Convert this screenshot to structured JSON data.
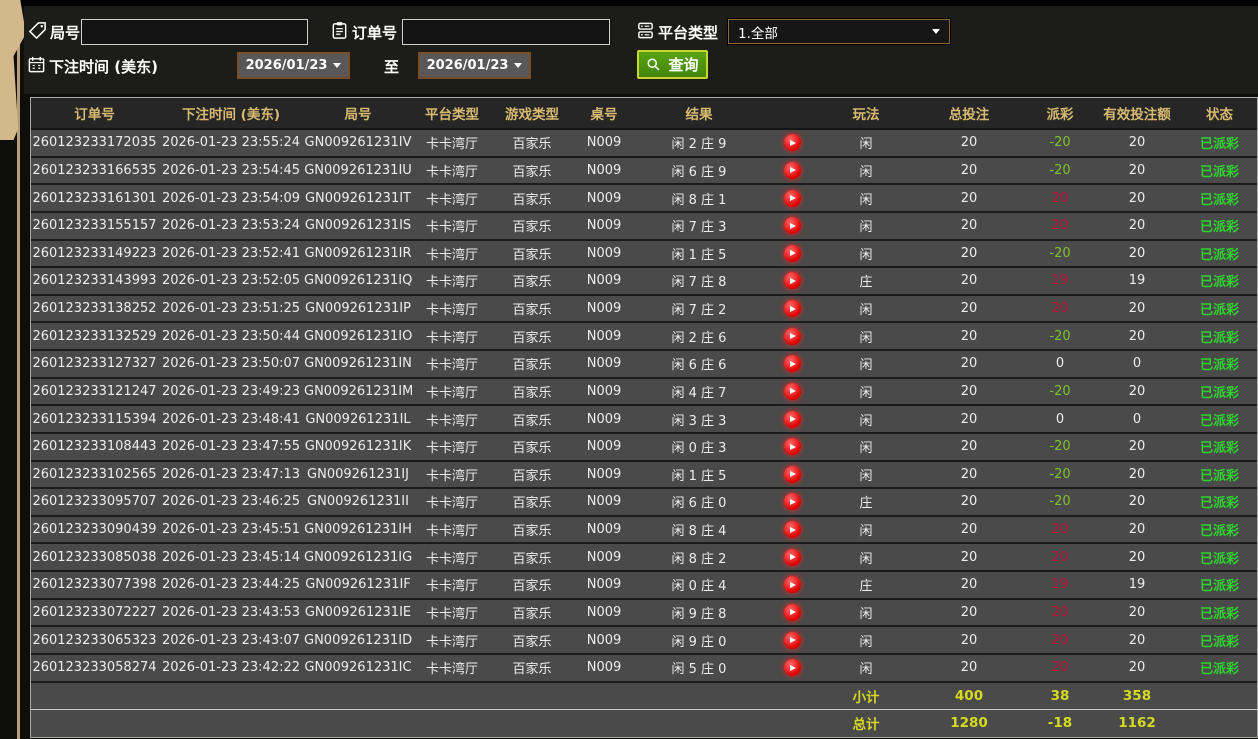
{
  "filter_bar": {
    "round": {
      "label": "局号",
      "value": "",
      "icon": "tag-icon"
    },
    "order": {
      "label": "订单号",
      "value": "",
      "icon": "clipboard-icon"
    },
    "platform": {
      "label": "平台类型",
      "value": "1.全部",
      "icon": "server-stack-icon"
    },
    "bet_time": {
      "label": "下注时间 (美东)",
      "icon": "calendar-icon",
      "from": "2026/01/23",
      "separator": "至",
      "to": "2026/01/23"
    },
    "search_button": {
      "label": "查询",
      "icon": "magnifier-icon"
    }
  },
  "table": {
    "headers": {
      "order": "订单号",
      "time": "下注时间 (美东)",
      "round": "局号",
      "platform": "平台类型",
      "game": "游戏类型",
      "table_no": "桌号",
      "result": "结果",
      "play": "玩法",
      "total_bet": "总投注",
      "payout": "派彩",
      "valid_bet": "有效投注额",
      "status": "状态"
    },
    "rows": [
      {
        "order": "260123233172035",
        "time": "2026-01-23 23:55:24",
        "round": "GN009261231IV",
        "platform": "卡卡湾厅",
        "game": "百家乐",
        "table_no": "N009",
        "result": "闲 2 庄 9",
        "play": "闲",
        "total_bet": "20",
        "payout": "-20",
        "valid_bet": "20",
        "status": "已派彩"
      },
      {
        "order": "260123233166535",
        "time": "2026-01-23 23:54:45",
        "round": "GN009261231IU",
        "platform": "卡卡湾厅",
        "game": "百家乐",
        "table_no": "N009",
        "result": "闲 6 庄 9",
        "play": "闲",
        "total_bet": "20",
        "payout": "-20",
        "valid_bet": "20",
        "status": "已派彩"
      },
      {
        "order": "260123233161301",
        "time": "2026-01-23 23:54:09",
        "round": "GN009261231IT",
        "platform": "卡卡湾厅",
        "game": "百家乐",
        "table_no": "N009",
        "result": "闲 8 庄 1",
        "play": "闲",
        "total_bet": "20",
        "payout": "20",
        "valid_bet": "20",
        "status": "已派彩"
      },
      {
        "order": "260123233155157",
        "time": "2026-01-23 23:53:24",
        "round": "GN009261231IS",
        "platform": "卡卡湾厅",
        "game": "百家乐",
        "table_no": "N009",
        "result": "闲 7 庄 3",
        "play": "闲",
        "total_bet": "20",
        "payout": "20",
        "valid_bet": "20",
        "status": "已派彩"
      },
      {
        "order": "260123233149223",
        "time": "2026-01-23 23:52:41",
        "round": "GN009261231IR",
        "platform": "卡卡湾厅",
        "game": "百家乐",
        "table_no": "N009",
        "result": "闲 1 庄 5",
        "play": "闲",
        "total_bet": "20",
        "payout": "-20",
        "valid_bet": "20",
        "status": "已派彩"
      },
      {
        "order": "260123233143993",
        "time": "2026-01-23 23:52:05",
        "round": "GN009261231IQ",
        "platform": "卡卡湾厅",
        "game": "百家乐",
        "table_no": "N009",
        "result": "闲 7 庄 8",
        "play": "庄",
        "total_bet": "20",
        "payout": "19",
        "valid_bet": "19",
        "status": "已派彩"
      },
      {
        "order": "260123233138252",
        "time": "2026-01-23 23:51:25",
        "round": "GN009261231IP",
        "platform": "卡卡湾厅",
        "game": "百家乐",
        "table_no": "N009",
        "result": "闲 7 庄 2",
        "play": "闲",
        "total_bet": "20",
        "payout": "20",
        "valid_bet": "20",
        "status": "已派彩"
      },
      {
        "order": "260123233132529",
        "time": "2026-01-23 23:50:44",
        "round": "GN009261231IO",
        "platform": "卡卡湾厅",
        "game": "百家乐",
        "table_no": "N009",
        "result": "闲 2 庄 6",
        "play": "闲",
        "total_bet": "20",
        "payout": "-20",
        "valid_bet": "20",
        "status": "已派彩"
      },
      {
        "order": "260123233127327",
        "time": "2026-01-23 23:50:07",
        "round": "GN009261231IN",
        "platform": "卡卡湾厅",
        "game": "百家乐",
        "table_no": "N009",
        "result": "闲 6 庄 6",
        "play": "闲",
        "total_bet": "20",
        "payout": "0",
        "valid_bet": "0",
        "status": "已派彩"
      },
      {
        "order": "260123233121247",
        "time": "2026-01-23 23:49:23",
        "round": "GN009261231IM",
        "platform": "卡卡湾厅",
        "game": "百家乐",
        "table_no": "N009",
        "result": "闲 4 庄 7",
        "play": "闲",
        "total_bet": "20",
        "payout": "-20",
        "valid_bet": "20",
        "status": "已派彩"
      },
      {
        "order": "260123233115394",
        "time": "2026-01-23 23:48:41",
        "round": "GN009261231IL",
        "platform": "卡卡湾厅",
        "game": "百家乐",
        "table_no": "N009",
        "result": "闲 3 庄 3",
        "play": "闲",
        "total_bet": "20",
        "payout": "0",
        "valid_bet": "0",
        "status": "已派彩"
      },
      {
        "order": "260123233108443",
        "time": "2026-01-23 23:47:55",
        "round": "GN009261231IK",
        "platform": "卡卡湾厅",
        "game": "百家乐",
        "table_no": "N009",
        "result": "闲 0 庄 3",
        "play": "闲",
        "total_bet": "20",
        "payout": "-20",
        "valid_bet": "20",
        "status": "已派彩"
      },
      {
        "order": "260123233102565",
        "time": "2026-01-23 23:47:13",
        "round": "GN009261231IJ",
        "platform": "卡卡湾厅",
        "game": "百家乐",
        "table_no": "N009",
        "result": "闲 1 庄 5",
        "play": "闲",
        "total_bet": "20",
        "payout": "-20",
        "valid_bet": "20",
        "status": "已派彩"
      },
      {
        "order": "260123233095707",
        "time": "2026-01-23 23:46:25",
        "round": "GN009261231II",
        "platform": "卡卡湾厅",
        "game": "百家乐",
        "table_no": "N009",
        "result": "闲 6 庄 0",
        "play": "庄",
        "total_bet": "20",
        "payout": "-20",
        "valid_bet": "20",
        "status": "已派彩"
      },
      {
        "order": "260123233090439",
        "time": "2026-01-23 23:45:51",
        "round": "GN009261231IH",
        "platform": "卡卡湾厅",
        "game": "百家乐",
        "table_no": "N009",
        "result": "闲 8 庄 4",
        "play": "闲",
        "total_bet": "20",
        "payout": "20",
        "valid_bet": "20",
        "status": "已派彩"
      },
      {
        "order": "260123233085038",
        "time": "2026-01-23 23:45:14",
        "round": "GN009261231IG",
        "platform": "卡卡湾厅",
        "game": "百家乐",
        "table_no": "N009",
        "result": "闲 8 庄 2",
        "play": "闲",
        "total_bet": "20",
        "payout": "20",
        "valid_bet": "20",
        "status": "已派彩"
      },
      {
        "order": "260123233077398",
        "time": "2026-01-23 23:44:25",
        "round": "GN009261231IF",
        "platform": "卡卡湾厅",
        "game": "百家乐",
        "table_no": "N009",
        "result": "闲 0 庄 4",
        "play": "庄",
        "total_bet": "20",
        "payout": "19",
        "valid_bet": "19",
        "status": "已派彩"
      },
      {
        "order": "260123233072227",
        "time": "2026-01-23 23:43:53",
        "round": "GN009261231IE",
        "platform": "卡卡湾厅",
        "game": "百家乐",
        "table_no": "N009",
        "result": "闲 9 庄 8",
        "play": "闲",
        "total_bet": "20",
        "payout": "20",
        "valid_bet": "20",
        "status": "已派彩"
      },
      {
        "order": "260123233065323",
        "time": "2026-01-23 23:43:07",
        "round": "GN009261231ID",
        "platform": "卡卡湾厅",
        "game": "百家乐",
        "table_no": "N009",
        "result": "闲 9 庄 0",
        "play": "闲",
        "total_bet": "20",
        "payout": "20",
        "valid_bet": "20",
        "status": "已派彩"
      },
      {
        "order": "260123233058274",
        "time": "2026-01-23 23:42:22",
        "round": "GN009261231IC",
        "platform": "卡卡湾厅",
        "game": "百家乐",
        "table_no": "N009",
        "result": "闲 5 庄 0",
        "play": "闲",
        "total_bet": "20",
        "payout": "20",
        "valid_bet": "20",
        "status": "已派彩"
      }
    ],
    "summary": {
      "subtotal": {
        "label": "小计",
        "total_bet": "400",
        "payout": "38",
        "valid_bet": "358"
      },
      "grand_total": {
        "label": "总计",
        "total_bet": "1280",
        "payout": "-18",
        "valid_bet": "1162"
      }
    },
    "row_icon": "replay-play-icon"
  },
  "colors": {
    "header_text_gold": "#d8ba70",
    "header_row_dark": "#262626",
    "row_gray": "#4a4a4a",
    "summary_yellow": "#d6da1f",
    "status_green": "#2ed32e",
    "payout_win_red": "#bd1038",
    "payout_loss_green": "#7fc32a",
    "search_button_green": "#58a312",
    "search_button_border": "#c7d72e",
    "date_border_brown": "#7a4f26",
    "frame_tan": "#d3b88c"
  }
}
